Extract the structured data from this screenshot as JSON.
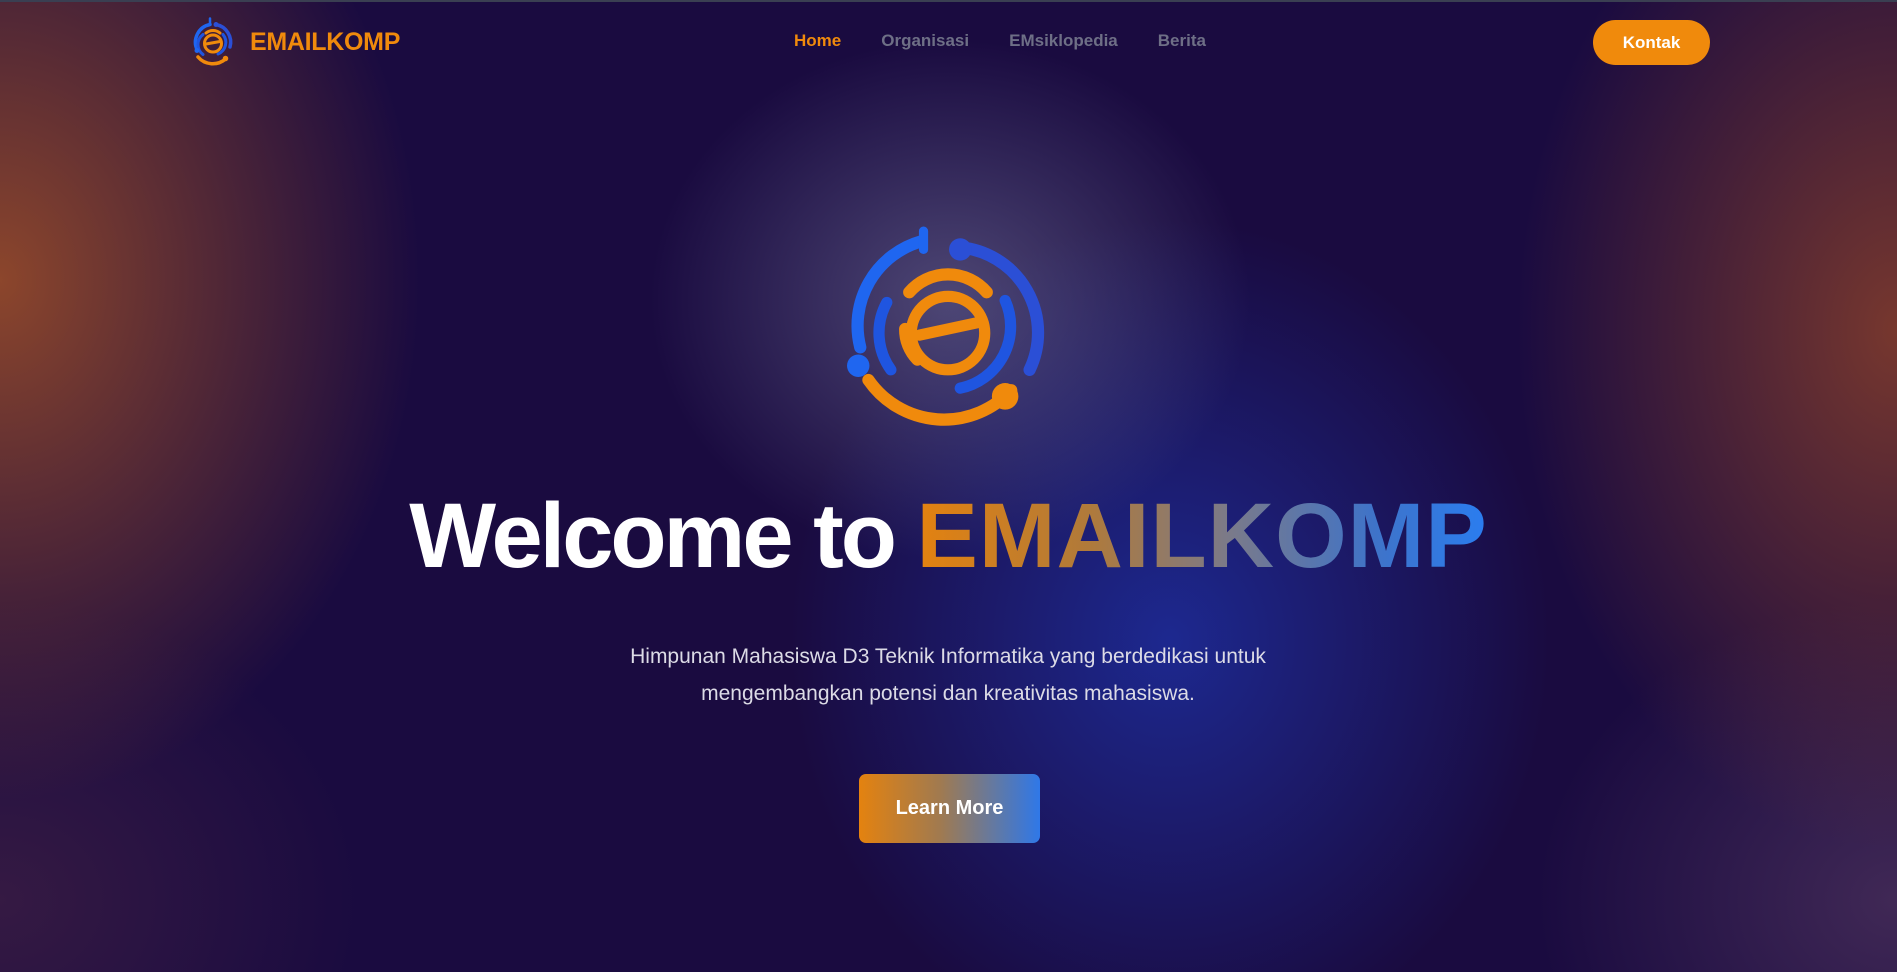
{
  "brand": {
    "name": "EMAILKOMP"
  },
  "nav": {
    "items": [
      {
        "label": "Home"
      },
      {
        "label": "Organisasi"
      },
      {
        "label": "EMsiklopedia"
      },
      {
        "label": "Berita"
      }
    ],
    "active": "Home",
    "contact_label": "Kontak"
  },
  "hero": {
    "title_prefix": "Welcome to ",
    "title_accent": "EMAILKOMP",
    "subtitle_line1": "Himpunan Mahasiswa D3 Teknik Informatika yang berdedikasi untuk",
    "subtitle_line2": "mengembangkan potensi dan kreativitas mahasiswa.",
    "cta_label": "Learn More"
  },
  "colors": {
    "accent_orange": "#f08a0c",
    "accent_blue": "#1f66f0",
    "background": "#1a0b40"
  },
  "icons": {
    "brand_logo": "emailkomp-logo-icon",
    "hero_logo": "emailkomp-logo-icon"
  }
}
